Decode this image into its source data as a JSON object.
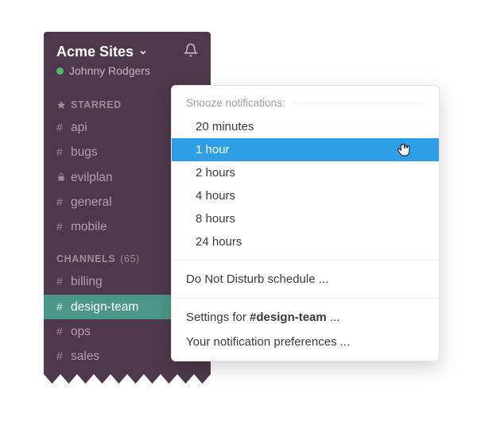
{
  "header": {
    "team_name": "Acme Sites",
    "user_name": "Johnny Rodgers"
  },
  "sections": {
    "starred": {
      "title": "STARRED",
      "items": [
        {
          "kind": "channel",
          "name": "api"
        },
        {
          "kind": "channel",
          "name": "bugs"
        },
        {
          "kind": "private",
          "name": "evilplan"
        },
        {
          "kind": "channel",
          "name": "general"
        },
        {
          "kind": "channel",
          "name": "mobile"
        }
      ]
    },
    "channels": {
      "title": "CHANNELS",
      "count": "(65)",
      "items": [
        {
          "name": "billing",
          "active": false
        },
        {
          "name": "design-team",
          "active": true
        },
        {
          "name": "ops",
          "active": false
        },
        {
          "name": "sales",
          "active": false
        }
      ]
    }
  },
  "popover": {
    "title": "Snooze notifications:",
    "options": [
      "20 minutes",
      "1 hour",
      "2 hours",
      "4 hours",
      "8 hours",
      "24 hours"
    ],
    "hovered_index": 1,
    "dnd_label": "Do Not Disturb schedule ...",
    "settings_label_prefix": "Settings for ",
    "settings_channel": "#design-team",
    "settings_label_suffix": " ...",
    "prefs_label": "Your notification preferences ..."
  }
}
